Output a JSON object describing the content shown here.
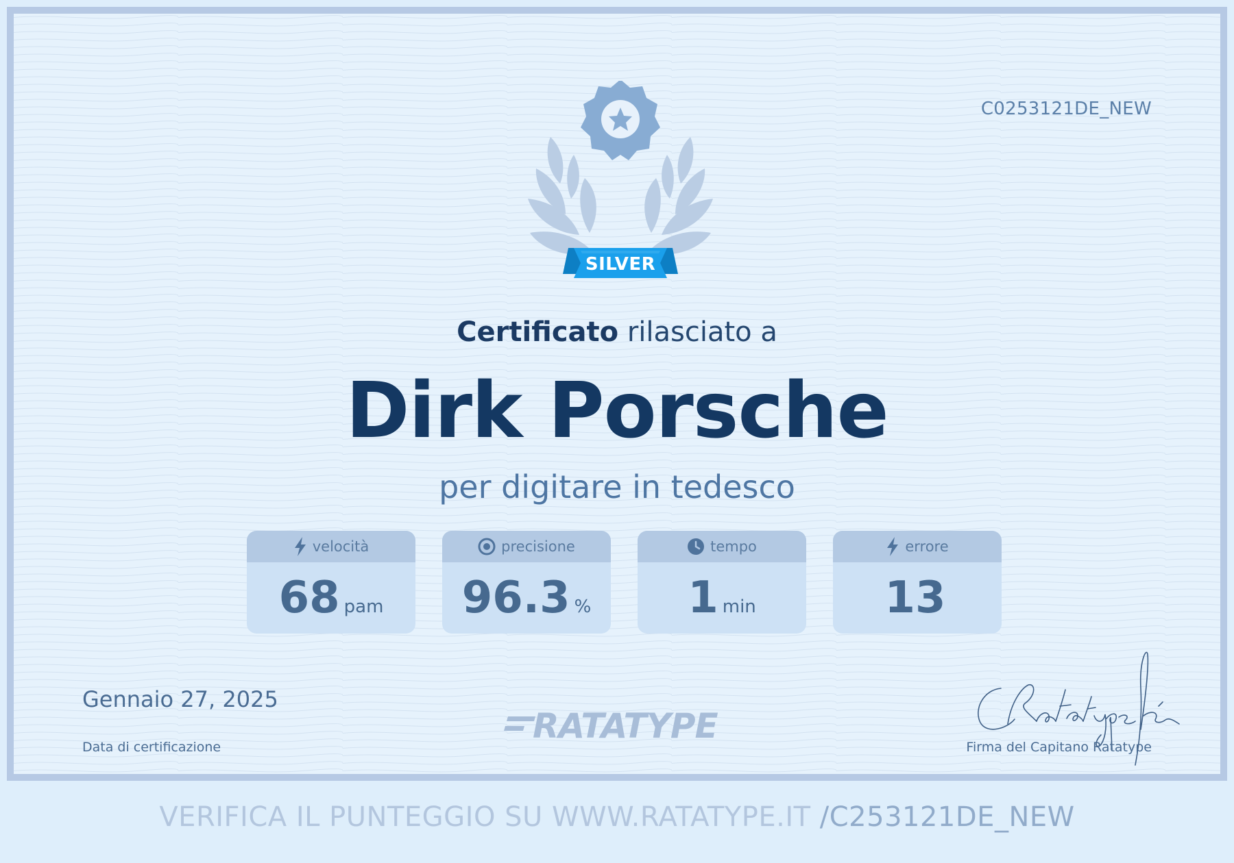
{
  "certificate": {
    "id": "C0253121DE_NEW",
    "badge_label": "SILVER",
    "issued_bold": "Certificato",
    "issued_rest": "rilasciato a",
    "recipient": "Dirk Porsche",
    "subtitle": "per digitare in tedesco",
    "date": "Gennaio 27, 2025",
    "date_label": "Data di certificazione",
    "signature_label": "Firma del Capitano Ratatype",
    "logo_text": "RATATYPE"
  },
  "stats": [
    {
      "icon": "lightning-icon",
      "label": "velocità",
      "value": "68",
      "unit": "pam"
    },
    {
      "icon": "target-icon",
      "label": "precisione",
      "value": "96.3",
      "unit": "%"
    },
    {
      "icon": "clock-icon",
      "label": "tempo",
      "value": "1",
      "unit": "min"
    },
    {
      "icon": "lightning-icon",
      "label": "errore",
      "value": "13",
      "unit": ""
    }
  ],
  "verify": {
    "text": "VERIFICA IL PUNTEGGIO SU WWW.RATATYPE.IT",
    "code": "/C253121DE_NEW"
  },
  "colors": {
    "frame": "#b6c9e4",
    "background": "#e6f2fc",
    "name": "#143862",
    "badge_ribbon": "#1aa0ec",
    "laurel": "#b9cde4",
    "medal": "#8aaed4"
  }
}
